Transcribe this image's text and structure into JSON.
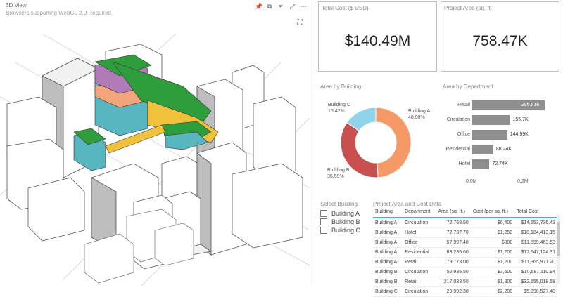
{
  "view3d": {
    "title": "3D View",
    "subtitle": "Browsers supporting WebGL 2.0 Required"
  },
  "kpi": {
    "cost": {
      "title": "Total Cost ($ USD)",
      "value": "$140.49M"
    },
    "area": {
      "title": "Project Area (sq. ft.)",
      "value": "758.47K"
    }
  },
  "area_building": {
    "title": "Area by Building",
    "labels": [
      {
        "name": "Building A",
        "pct": "48.98%"
      },
      {
        "name": "Building B",
        "pct": "35.59%"
      },
      {
        "name": "Building C",
        "pct": "15.42%"
      }
    ]
  },
  "area_department": {
    "title": "Area by Department",
    "axis": [
      "0.0M",
      "0.2M"
    ]
  },
  "slicer": {
    "title": "Select Building",
    "items": [
      "Building A",
      "Building B",
      "Building C"
    ]
  },
  "table": {
    "title": "Project Area and Cost Data",
    "headers": [
      "Building",
      "Department",
      "Area (sq. ft.)",
      "Cost (per sq. ft.)",
      "Total Cost"
    ],
    "rows": [
      [
        "Building A",
        "Circulation",
        "72,768.50",
        "$6,400",
        "$14,553,736.43"
      ],
      [
        "Building A",
        "Hotel",
        "72,737.70",
        "$1,250",
        "$18,184,413.15"
      ],
      [
        "Building A",
        "Office",
        "57,997.40",
        "$800",
        "$11,599,463.53"
      ],
      [
        "Building A",
        "Residential",
        "88,235.60",
        "$1,200",
        "$17,647,124.31"
      ],
      [
        "Building A",
        "Retail",
        "79,773.00",
        "$1,200",
        "$11,965,971.20"
      ],
      [
        "Building B",
        "Circulation",
        "52,935.50",
        "$3,600",
        "$10,587,110.94"
      ],
      [
        "Building B",
        "Retail",
        "217,033.50",
        "$1,800",
        "$32,555,018.58"
      ],
      [
        "Building C",
        "Circulation",
        "29,992.30",
        "$2,200",
        "$5,998,527.40"
      ]
    ]
  },
  "chart_data": [
    {
      "type": "pie",
      "title": "Area by Building",
      "categories": [
        "Building A",
        "Building B",
        "Building C"
      ],
      "values": [
        48.98,
        35.59,
        15.42
      ],
      "colors": [
        "#f59a66",
        "#c8504e",
        "#8fd4ea"
      ]
    },
    {
      "type": "bar",
      "title": "Area by Department",
      "categories": [
        "Retail",
        "Circulation",
        "Office",
        "Residential",
        "Hotel"
      ],
      "values": [
        296.81,
        155.7,
        144.99,
        88.24,
        72.74
      ],
      "labels": [
        "296.81K",
        "155.7K",
        "144.99K",
        "88.24K",
        "72.74K"
      ],
      "xlim": [
        0,
        0.3
      ],
      "xticks": [
        "0.0M",
        "0.2M"
      ],
      "units": "K sq. ft.",
      "color": "#8f8f8f"
    }
  ]
}
